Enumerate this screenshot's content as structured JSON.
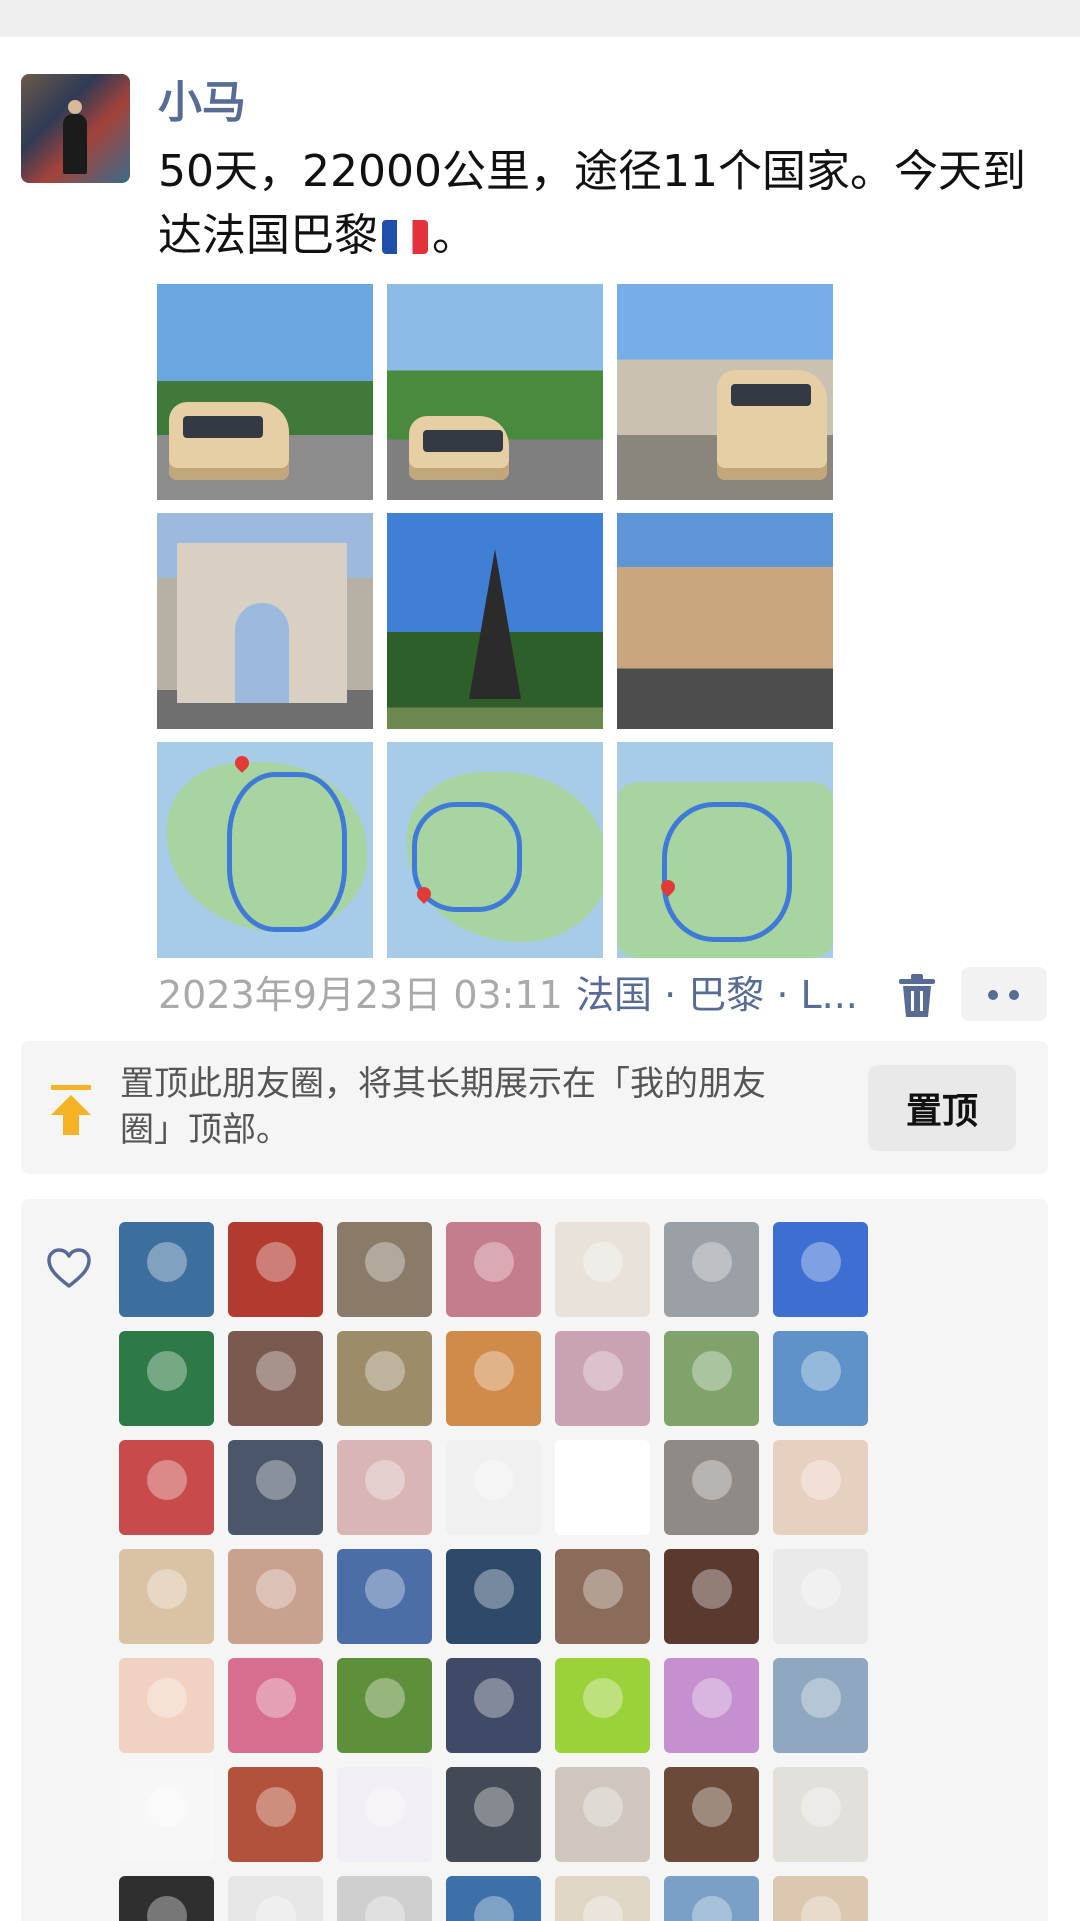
{
  "post": {
    "username": "小马",
    "text": "50天，22000公里，途径11个国家。今天到达法国巴黎",
    "text_suffix": "。",
    "time": "2023年9月23日 03:11",
    "location": "法国 · 巴黎 · L..."
  },
  "photos": [
    {
      "name": "van-at-eiffel-photo"
    },
    {
      "name": "van-near-eiffel-photo"
    },
    {
      "name": "van-at-arc-photo"
    },
    {
      "name": "arc-de-triomphe-photo"
    },
    {
      "name": "eiffel-tower-photo"
    },
    {
      "name": "paris-street-photo"
    },
    {
      "name": "route-map-russia-photo"
    },
    {
      "name": "route-map-scandinavia-photo"
    },
    {
      "name": "route-map-europe-photo"
    }
  ],
  "pin_card": {
    "text": "置顶此朋友圈，将其长期展示在「我的朋友圈」顶部。",
    "button": "置顶"
  },
  "likes": {
    "avatar_colors": [
      "#3d6f9e",
      "#b23a2f",
      "#8a7a68",
      "#c57d8d",
      "#e9e2da",
      "#9aa0a6",
      "#3c6fd1",
      "#2e7a46",
      "#7a5a4f",
      "#9c8c6a",
      "#d08a4a",
      "#c9a2b3",
      "#7fa36b",
      "#5e92c8",
      "#c94a4a",
      "#4c566a",
      "#d9b5b5",
      "#f0f0f0",
      "#ffffff",
      "#8f8a86",
      "#e8d0c0",
      "#d9c3a4",
      "#c9a18f",
      "#4b6ea8",
      "#2d4a6a",
      "#8b6b5a",
      "#5a3a2f",
      "#eaeaea",
      "#f1d1c2",
      "#d66f8e",
      "#5e8f3a",
      "#3f4a66",
      "#9bd23a",
      "#c58fd0",
      "#8fa8c0",
      "#f7f7f7",
      "#b2523a",
      "#f2eef6",
      "#444a55",
      "#cfc7bd",
      "#6b4a3a",
      "#e3e0dc",
      "#2f2f2f",
      "#e6e6e6",
      "#cfcfcf",
      "#3d6fa8",
      "#e0d6c6",
      "#7aa0c8",
      "#dcc8b0"
    ]
  },
  "colors": {
    "link": "#576b95",
    "pin_icon": "#f5b325",
    "meta_gray": "#a9a9a9"
  }
}
